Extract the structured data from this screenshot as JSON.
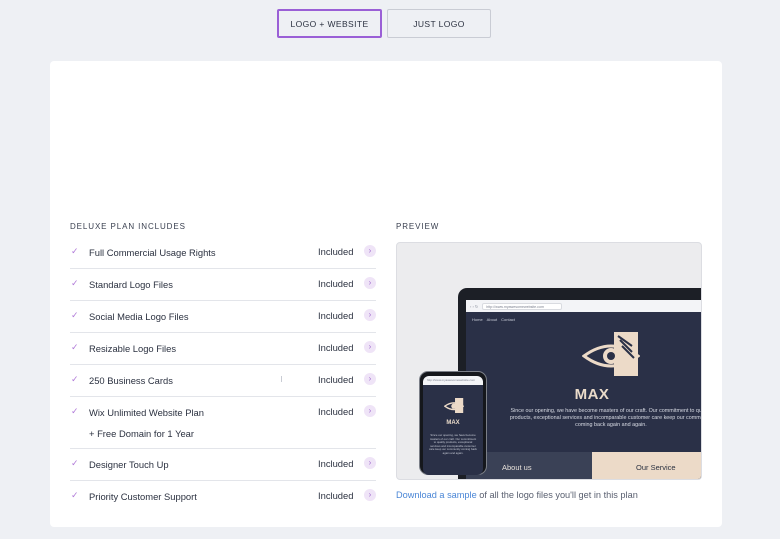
{
  "tabs": [
    {
      "label": "LOGO + WEBSITE",
      "active": true
    },
    {
      "label": "JUST LOGO",
      "active": false
    }
  ],
  "plan": {
    "title": "DELUXE PLAN INCLUDES",
    "features": [
      {
        "label": "Full Commercial Usage Rights",
        "status": "Included"
      },
      {
        "label": "Standard Logo Files",
        "status": "Included"
      },
      {
        "label": "Social Media Logo Files",
        "status": "Included"
      },
      {
        "label": "Resizable Logo Files",
        "status": "Included"
      },
      {
        "label": "250 Business Cards",
        "status": "Included"
      },
      {
        "label": "Wix Unlimited Website Plan",
        "sub": "+ Free Domain for 1 Year",
        "status": "Included"
      },
      {
        "label": "Designer Touch Up",
        "status": "Included"
      },
      {
        "label": "Priority Customer Support",
        "status": "Included"
      }
    ]
  },
  "preview": {
    "title": "PREVIEW",
    "mockup": {
      "url": "http://www.myawesomewebsite.com",
      "nav": [
        "Home",
        "About",
        "Contact"
      ],
      "brand": "MAX",
      "tagline": "Since our opening, we have become masters of our craft. Our commitment to quality products, exceptional services and incomparable customer care keep our community coming back again and again.",
      "about": "About us",
      "service": "Our Service"
    },
    "download_link": "Download a sample",
    "download_text": " of all the logo files you'll get in this plan"
  },
  "colors": {
    "accent": "#9a5fd6",
    "link": "#4a86d6",
    "navy": "#2a3047",
    "sand": "#ecdac8"
  }
}
